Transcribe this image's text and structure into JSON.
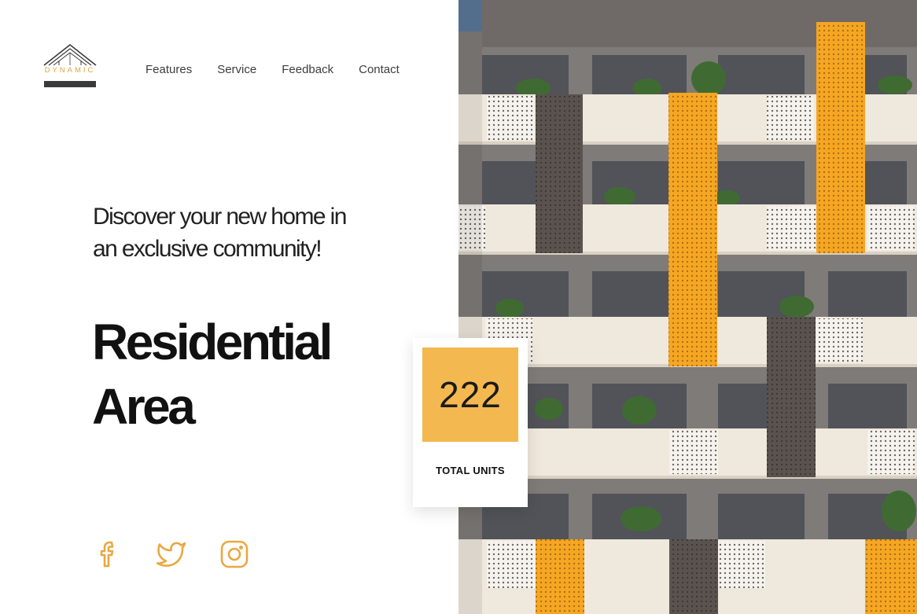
{
  "brand": {
    "name": "DYNAMIC",
    "accent": "#e0a53c"
  },
  "nav": {
    "items": [
      "Features",
      "Service",
      "Feedback",
      "Contact"
    ]
  },
  "hero": {
    "tagline": "Discover your new home in an exclusive community!",
    "headline_line1": "Residential",
    "headline_line2": "Area"
  },
  "stat": {
    "value": "222",
    "label": "TOTAL UNITS",
    "box_color": "#f3b84f"
  },
  "social": {
    "icons": [
      "facebook-icon",
      "twitter-icon",
      "instagram-icon"
    ],
    "color": "#e9a840"
  },
  "image": {
    "subject": "building-facade",
    "panel_color": "#f5a623"
  }
}
